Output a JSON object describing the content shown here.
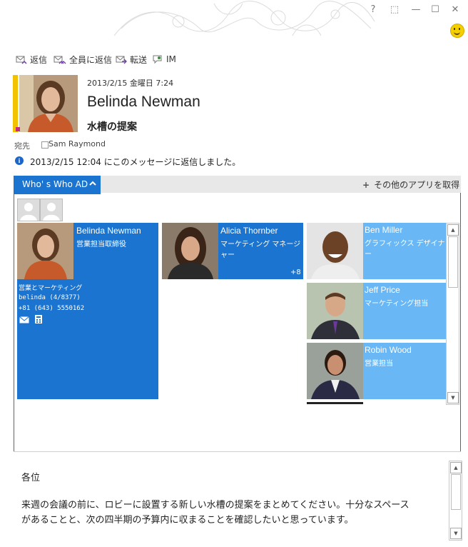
{
  "window": {
    "buttons": [
      "?",
      "⬚",
      "—",
      "☐",
      "✕"
    ]
  },
  "toolbar": {
    "reply": "返信",
    "reply_all": "全員に返信",
    "forward": "転送",
    "im": "IM"
  },
  "message": {
    "date": "2013/2/15 金曜日 7:24",
    "sender": "Belinda Newman",
    "subject": "水槽の提案",
    "to_label": "宛先",
    "to_name": "Sam Raymond",
    "info": "2013/2/15 12:04 にこのメッセージに返信しました。"
  },
  "app": {
    "tab_label": "Who' s Who AD",
    "get_more": "その他のアプリを取得",
    "primary": {
      "name": "Belinda Newman",
      "title": "営業担当取締役",
      "department": "営業とマーケティング",
      "alias": "belinda (4/8377)",
      "phone": "+81 (643) 5550162"
    },
    "manager": {
      "name": "Alicia Thornber",
      "title": "マーケティング マネージャー",
      "count": "+8"
    },
    "reports": [
      {
        "name": "Ben Miller",
        "title": "グラフィックス デザイナー"
      },
      {
        "name": "Jeff Price",
        "title": "マーケティング担当"
      },
      {
        "name": "Robin Wood",
        "title": "営業担当"
      }
    ]
  },
  "body": {
    "greeting": "各位",
    "line1": "来週の会議の前に、ロビーに設置する新しい水槽の提案をまとめてください。十分なスペース",
    "line2": "があることと、次の四半期の予算内に収まることを確認したいと思っています。"
  },
  "colors": {
    "accent": "#1b74d0",
    "light": "#69b7f4",
    "flag": "#f2c200"
  }
}
